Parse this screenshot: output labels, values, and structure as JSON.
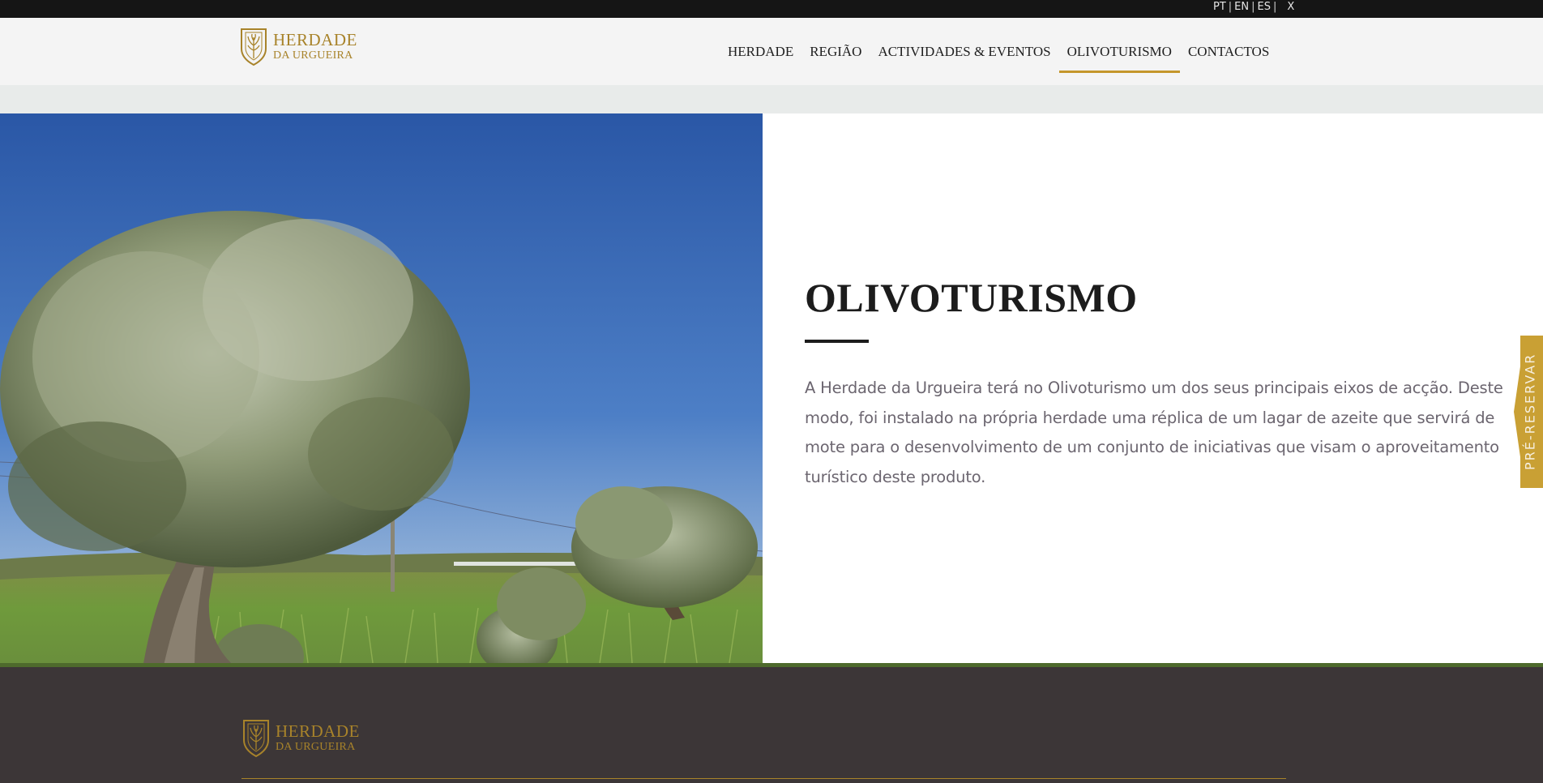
{
  "language_bar": {
    "languages": [
      "PT",
      "EN",
      "ES"
    ],
    "separator": "|",
    "close_label": "X"
  },
  "brand": {
    "name_line1": "HERDADE",
    "name_line2": "DA URGUEIRA",
    "color": "#a8832a"
  },
  "nav": {
    "items": [
      {
        "label": "HERDADE"
      },
      {
        "label": "REGIÃO"
      },
      {
        "label": "ACTIVIDADES & EVENTOS"
      },
      {
        "label": "OLIVOTURISMO"
      },
      {
        "label": "CONTACTOS"
      }
    ],
    "active_index": 3,
    "accent_color": "#c4962b"
  },
  "hero": {
    "image_icon": "olive-tree-photo"
  },
  "main": {
    "title": "OLIVOTURISMO",
    "paragraph": "A Herdade da Urgueira terá no Olivoturismo um dos seus principais eixos de acção. Deste modo, foi instalado na própria herdade uma réplica de um lagar de azeite que servirá de mote para o desenvolvimento de um conjunto de iniciativas que visam o aproveitamento turístico deste produto."
  },
  "side_tab": {
    "label": "PRÉ-RESERVAR",
    "color": "#c9a034"
  },
  "footer": {
    "background": "#3c3637",
    "stripe_color": "#4e6a2c"
  }
}
